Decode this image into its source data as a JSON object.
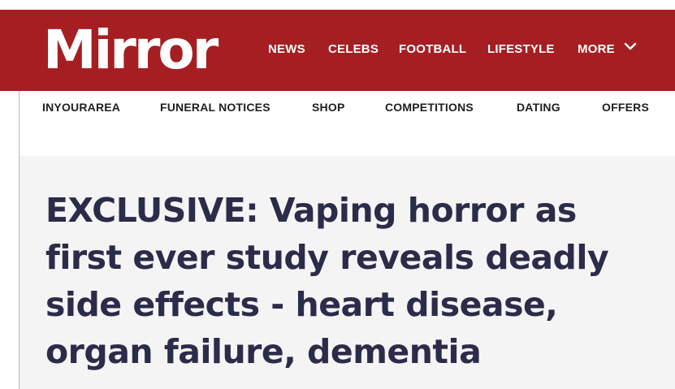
{
  "brand": {
    "logo_text": "Mirror",
    "masthead_color": "#a51f22"
  },
  "main_nav": {
    "items": [
      {
        "label": "NEWS"
      },
      {
        "label": "CELEBS"
      },
      {
        "label": "FOOTBALL"
      },
      {
        "label": "LIFESTYLE"
      },
      {
        "label": "MORE"
      }
    ],
    "more_icon": "chevron-down-icon"
  },
  "sub_nav": {
    "items": [
      {
        "label": "INYOURAREA"
      },
      {
        "label": "FUNERAL NOTICES"
      },
      {
        "label": "SHOP"
      },
      {
        "label": "COMPETITIONS"
      },
      {
        "label": "DATING"
      },
      {
        "label": "OFFERS"
      }
    ]
  },
  "article": {
    "headline": "EXCLUSIVE: Vaping horror as first ever study reveals deadly side effects - heart disease, organ failure, dementia",
    "headline_color": "#2b2b4a"
  }
}
